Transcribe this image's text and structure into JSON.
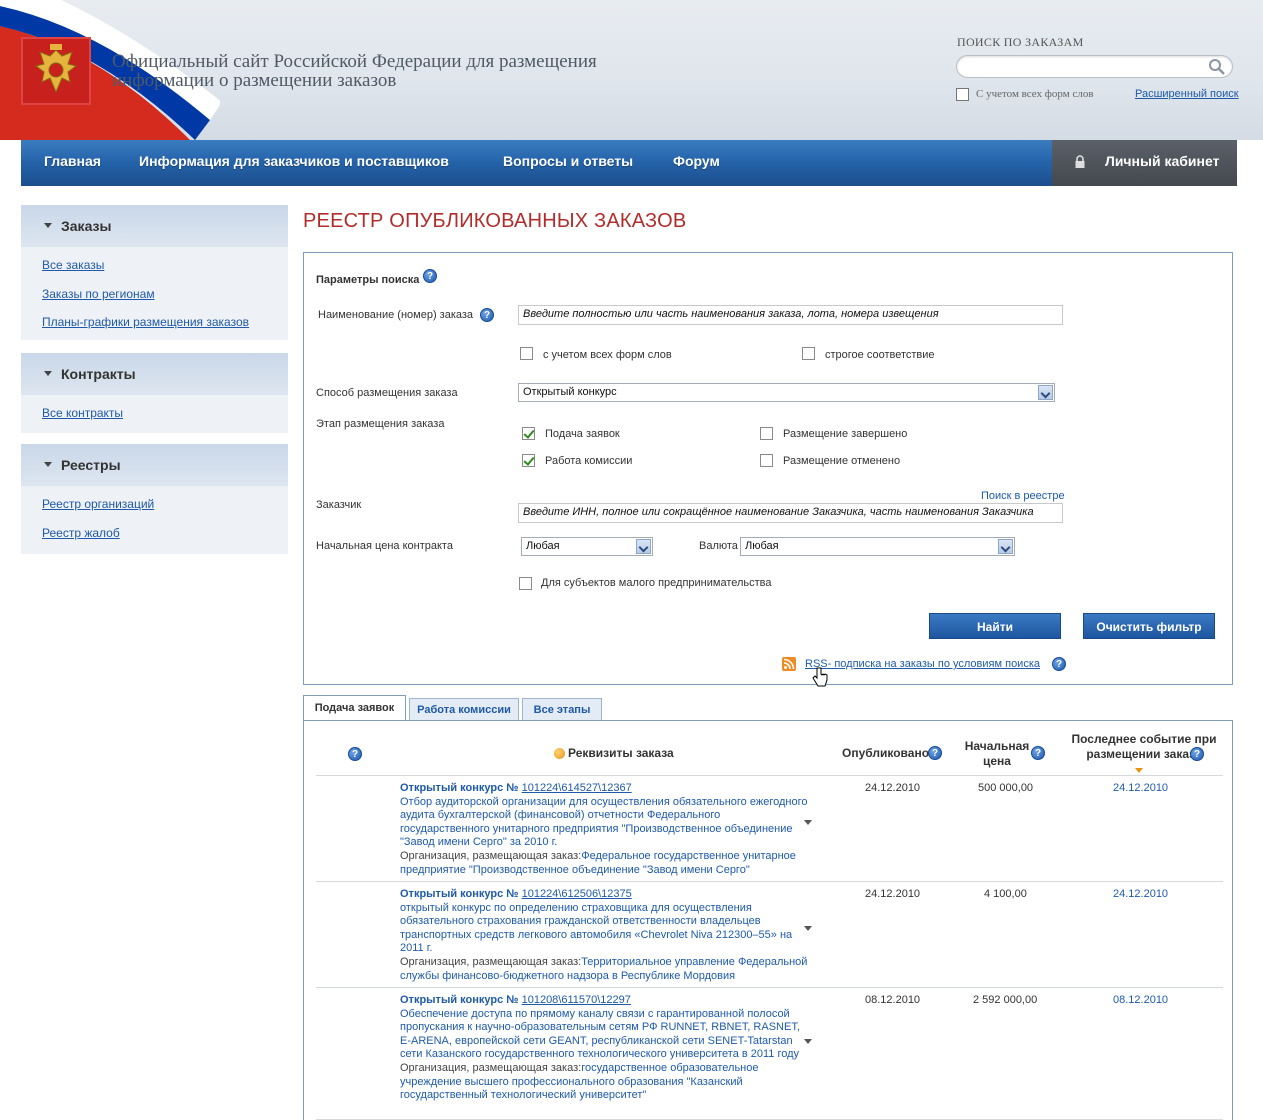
{
  "header": {
    "site_title": "Официальный сайт Российской Федерации для размещения информации о размещении заказов",
    "search_label": "ПОИСК ПО ЗАКАЗАМ",
    "search_value": "",
    "wordforms_label": "С учетом всех форм слов",
    "advanced_link": "Расширенный поиск"
  },
  "nav": {
    "items": [
      "Главная",
      "Информация для заказчиков и поставщиков",
      "Вопросы и ответы",
      "Форум"
    ],
    "cabinet": "Личный кабинет"
  },
  "sidebar": {
    "orders": {
      "title": "Заказы",
      "links": [
        "Все заказы",
        "Заказы по регионам",
        "Планы-графики размещения заказов"
      ]
    },
    "contracts": {
      "title": "Контракты",
      "links": [
        "Все контракты"
      ]
    },
    "registries": {
      "title": "Реестры",
      "links": [
        "Реестр организаций",
        "Реестр жалоб"
      ]
    }
  },
  "page_title": "РЕЕСТР ОПУБЛИКОВАННЫХ ЗАКАЗОВ",
  "filter": {
    "heading": "Параметры поиска",
    "name_label": "Наименование (номер) заказа",
    "name_value": "Введите полностью или часть наименования заказа, лота, номера извещения",
    "wordforms": "с учетом всех форм слов",
    "strict": "строгое соответствие",
    "method_label": "Способ размещения заказа",
    "method_value": "Открытый конкурс",
    "stage_label": "Этап размещения заказа",
    "stage_submission": "Подача заявок",
    "stage_commission": "Работа комиссии",
    "stage_completed": "Размещение завершено",
    "stage_cancelled": "Размещение отменено",
    "registry_link": "Поиск в реестре",
    "customer_label": "Заказчик",
    "customer_value": "Введите ИНН, полное или сокращённое наименование Заказчика, часть наименования Заказчика",
    "price_label": "Начальная цена контракта",
    "price_value": "Любая",
    "currency_label": "Валюта",
    "currency_value": "Любая",
    "small_business": "Для субъектов малого предпринимательства",
    "find_button": "Найти",
    "clear_button": "Очистить фильтр",
    "rss_link": "RSS- подписка на заказы по условиям поиска",
    "help": "?"
  },
  "tabs": [
    "Подача заявок",
    "Работа комиссии",
    "Все этапы"
  ],
  "table": {
    "headers": {
      "details": "Реквизиты заказа",
      "published": "Опубликовано",
      "price": "Начальная цена",
      "event": "Последнее событие при размещении заказа"
    },
    "rows": [
      {
        "type": "Открытый конкурс №",
        "number": "101224\\614527\\12367",
        "description": "Отбор аудиторской организации для осуществления обязательного ежегодного аудита бухгалтерской (финансовой) отчетности Федерального государственного унитарного предприятия \"Производственное объединение \"Завод имени Серго\" за 2010 г.",
        "org_label": "Организация, размещающая заказ:",
        "org": "Федеральное государственное унитарное предприятие \"Производственное объединение \"Завод имени Серго\"",
        "published": "24.12.2010",
        "price": "500 000,00",
        "event": "24.12.2010"
      },
      {
        "type": "Открытый конкурс №",
        "number": "101224\\612506\\12375",
        "description": "открытый конкурс по определению страховщика для осуществления обязательного страхования гражданской ответственности владельцев транспортных средств легкового автомобиля «Chevrolet Niva 212300–55» на 2011 г.",
        "org_label": "Организация, размещающая заказ:",
        "org": "Территориальное управление Федеральной службы финансово-бюджетного надзора в Республике Мордовия",
        "published": "24.12.2010",
        "price": "4 100,00",
        "event": "24.12.2010"
      },
      {
        "type": "Открытый конкурс №",
        "number": "101208\\611570\\12297",
        "description": "Обеспечение доступа по прямому каналу связи с гарантированной полосой пропускания к научно-образовательным сетям РФ RUNNET, RBNET, RASNET, E-ARENA, европейской сети GEANT, республиканской сети SENET-Tatarstan сети Казанского государственного технологического университета в 2011 году",
        "org_label": "Организация, размещающая заказ:",
        "org": "государственное образовательное учреждение высшего профессионального образования \"Казанский государственный технологический университет\"",
        "published": "08.12.2010",
        "price": "2 592 000,00",
        "event": "08.12.2010"
      }
    ]
  }
}
